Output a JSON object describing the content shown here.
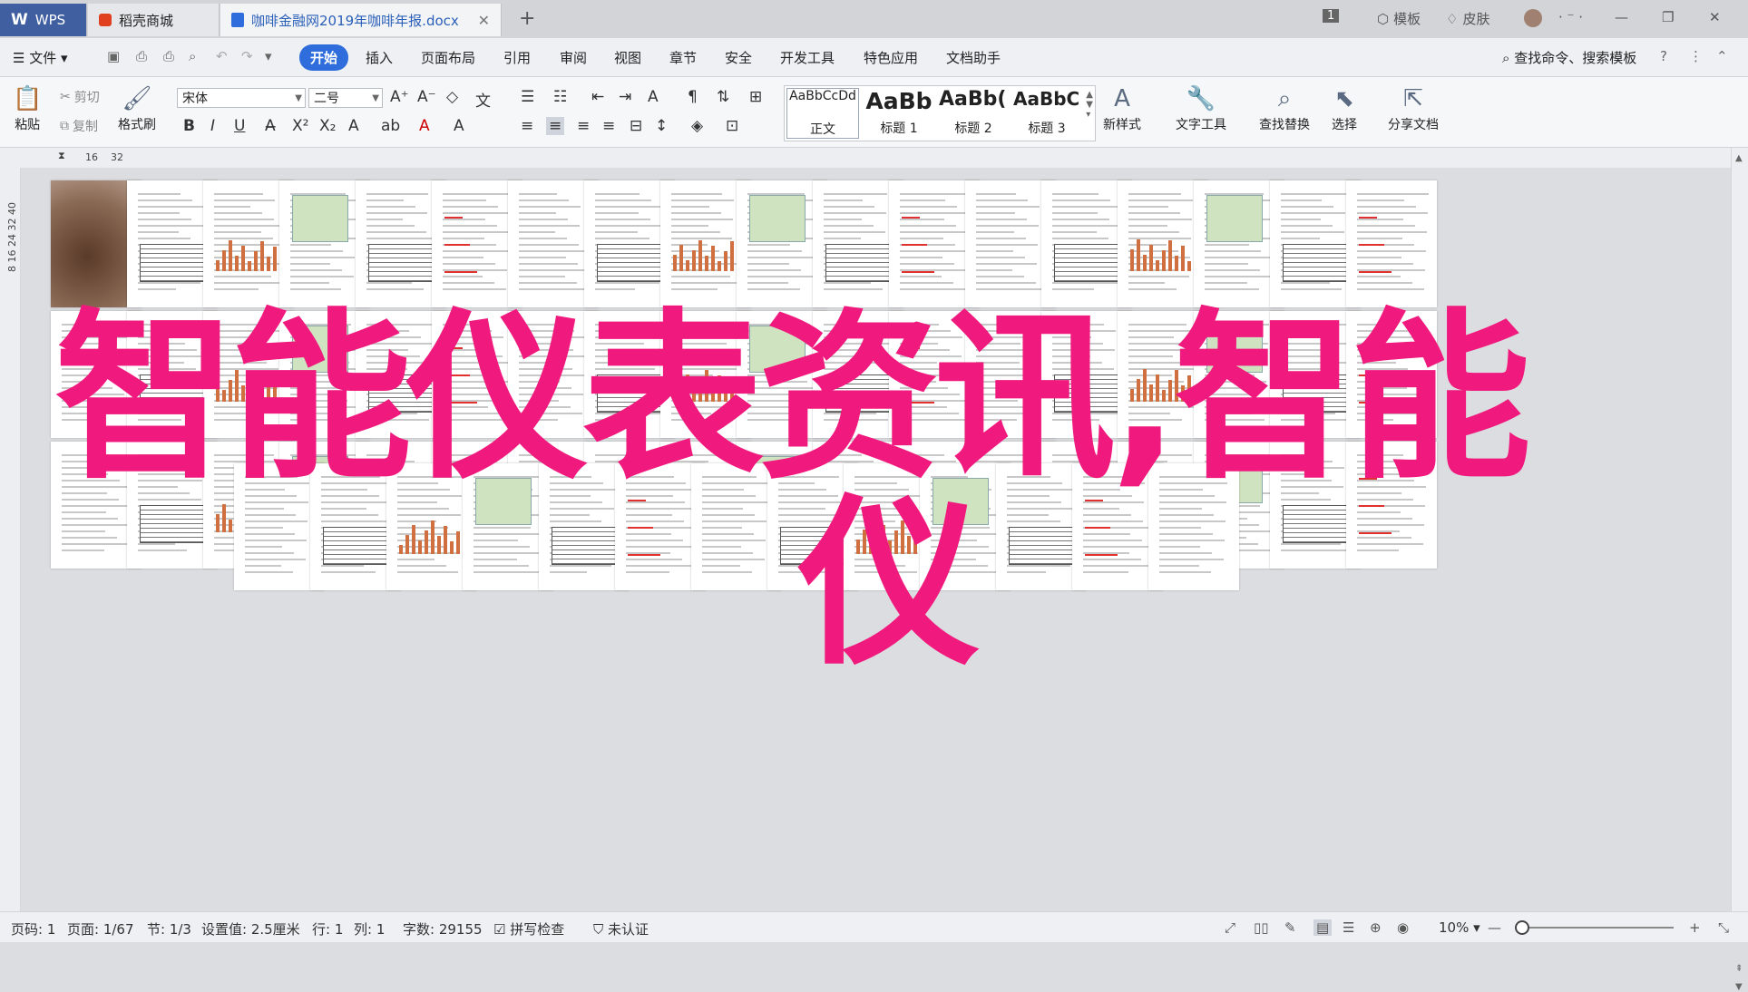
{
  "titlebar": {
    "app_tab": "WPS",
    "store_tab": "稻壳商城",
    "doc_tab": "咖啡金融网2019年咖啡年报.docx",
    "page_count_badge": "1",
    "template_label": "模板",
    "skin_label": "皮肤"
  },
  "menubar": {
    "file": "文件",
    "items": [
      "开始",
      "插入",
      "页面布局",
      "引用",
      "审阅",
      "视图",
      "章节",
      "安全",
      "开发工具",
      "特色应用",
      "文档助手"
    ],
    "search": "查找命令、搜索模板"
  },
  "ribbon": {
    "paste": "粘贴",
    "cut": "剪切",
    "copy": "复制",
    "format_painter": "格式刷",
    "font_name": "宋体",
    "font_size": "二号",
    "styles": [
      {
        "sample": "AaBbCcDd",
        "name": "正文"
      },
      {
        "sample": "AaBb",
        "name": "标题 1"
      },
      {
        "sample": "AaBb(",
        "name": "标题 2"
      },
      {
        "sample": "AaBbC",
        "name": "标题 3"
      }
    ],
    "new_style": "新样式",
    "text_tools": "文字工具",
    "find_replace": "查找替换",
    "select": "选择",
    "share_doc": "分享文档"
  },
  "ruler": {
    "marks": [
      "16",
      "32"
    ]
  },
  "vruler": {
    "marks": [
      "8",
      "16",
      "24",
      "32",
      "40"
    ]
  },
  "watermark": {
    "line1": "智能仪表资讯,智能",
    "line2": "仪"
  },
  "statusbar": {
    "page_num": "页码: 1",
    "page": "页面: 1/67",
    "section": "节: 1/3",
    "setting": "设置值: 2.5厘米",
    "row": "行: 1",
    "col": "列: 1",
    "words": "字数: 29155",
    "spell": "拼写检查",
    "cert": "未认证",
    "zoom": "10%"
  },
  "colors": {
    "accent": "#2f6ddc",
    "watermark": "#f0197d",
    "wps_tab": "#3f5fa0"
  }
}
